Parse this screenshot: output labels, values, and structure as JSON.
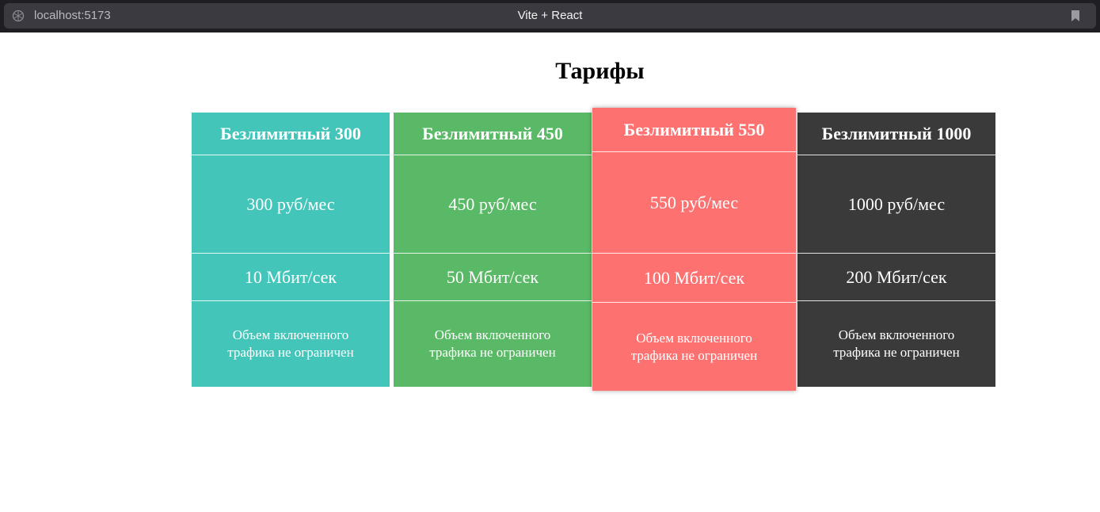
{
  "browser": {
    "url": "localhost:5173",
    "tab_title": "Vite + React"
  },
  "page": {
    "title": "Тарифы"
  },
  "plans": [
    {
      "name": "Безлимитный 300",
      "price": "300 руб/мес",
      "speed": "10 Мбит/сек",
      "traffic": "Объем включенного трафика не ограничен",
      "color": "#44c5b9"
    },
    {
      "name": "Безлимитный 450",
      "price": "450 руб/мес",
      "speed": "50 Мбит/сек",
      "traffic": "Объем включенного трафика не ограничен",
      "color": "#5ab966"
    },
    {
      "name": "Безлимитный 550",
      "price": "550 руб/мес",
      "speed": "100 Мбит/сек",
      "traffic": "Объем включенного трафика не ограничен",
      "color": "#fe7171",
      "selected": true
    },
    {
      "name": "Безлимитный 1000",
      "price": "1000 руб/мес",
      "speed": "200 Мбит/сек",
      "traffic": "Объем включенного трафика не ограничен",
      "color": "#3a3a3a"
    }
  ],
  "icons": {
    "site": "globe-icon",
    "bookmark": "bookmark-icon"
  }
}
